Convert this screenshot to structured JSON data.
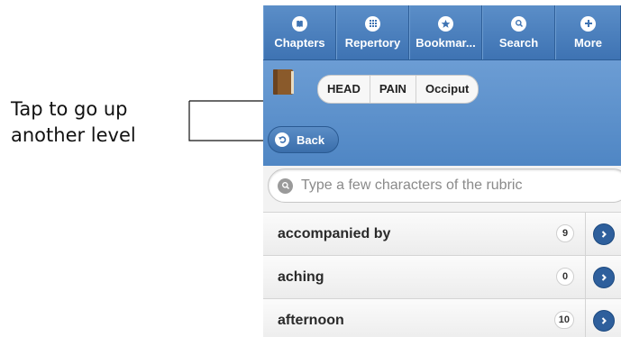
{
  "callout": {
    "line1": "Tap to go up",
    "line2": "another level"
  },
  "nav": {
    "items": [
      {
        "label": "Chapters",
        "icon": "book-icon"
      },
      {
        "label": "Repertory",
        "icon": "grid-icon"
      },
      {
        "label": "Bookmar...",
        "icon": "star-icon"
      },
      {
        "label": "Search",
        "icon": "search-icon"
      },
      {
        "label": "More",
        "icon": "plus-icon"
      }
    ]
  },
  "breadcrumb": {
    "items": [
      "HEAD",
      "PAIN",
      "Occiput"
    ]
  },
  "back": {
    "label": "Back"
  },
  "search": {
    "placeholder": "Type a few characters of the rubric"
  },
  "rubrics": [
    {
      "label": "accompanied by",
      "count": "9"
    },
    {
      "label": "aching",
      "count": "0"
    },
    {
      "label": "afternoon",
      "count": "10"
    }
  ],
  "colors": {
    "nav_bg": "#4a7fbf",
    "header_bg": "#5f93cc",
    "arrow": "#2e5f9c"
  }
}
